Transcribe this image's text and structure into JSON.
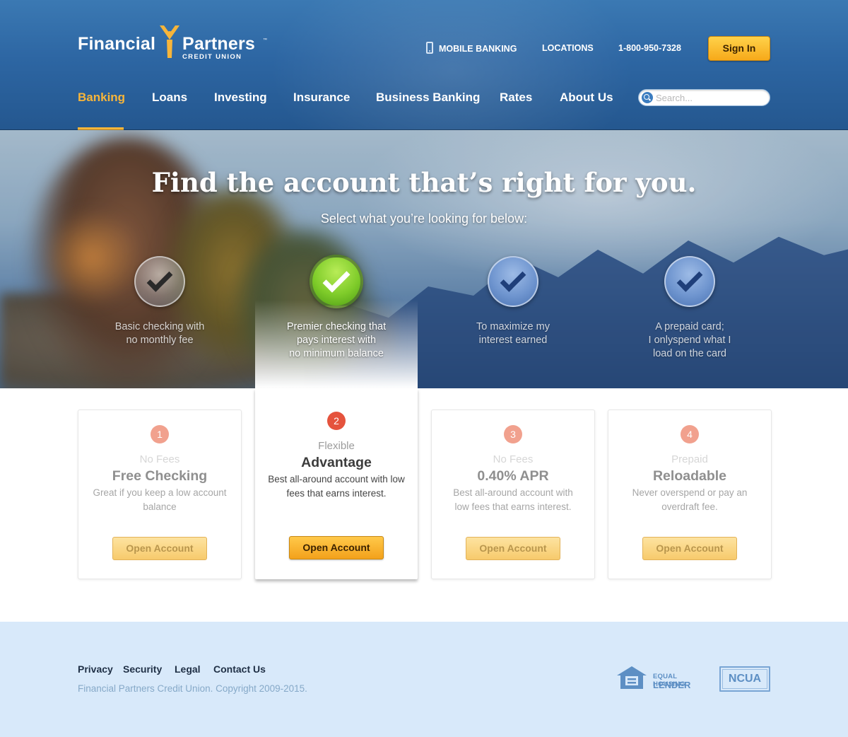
{
  "brand": {
    "name_part1": "Financial",
    "name_part2": "Partners",
    "trademark": "™",
    "subtitle": "CREDIT UNION"
  },
  "utility_nav": {
    "mobile_banking": "MOBILE BANKING",
    "locations": "LOCATIONS",
    "phone": "1-800-950-7328",
    "sign_in": "Sign In"
  },
  "main_nav": {
    "items": [
      {
        "label": "Banking",
        "active": true
      },
      {
        "label": "Loans"
      },
      {
        "label": "Investing"
      },
      {
        "label": "Insurance"
      },
      {
        "label": "Business Banking"
      },
      {
        "label": "Rates"
      },
      {
        "label": "About Us"
      }
    ]
  },
  "search": {
    "placeholder": "Search...",
    "value": ""
  },
  "hero": {
    "title": "Find the account that’s right for you.",
    "subtitle": "Select what you’re looking for below:",
    "options": [
      {
        "text": "Basic checking with\nno monthly fee",
        "selected": false
      },
      {
        "text": "Premier checking that\npays interest with\nno minimum balance",
        "selected": true
      },
      {
        "text": "To maximize my\ninterest earned",
        "selected": false
      },
      {
        "text": "A prepaid card;\nI onlyspend what I\nload on the card",
        "selected": false
      }
    ]
  },
  "cards": [
    {
      "number": "1",
      "kicker": "No Fees",
      "title": "Free Checking",
      "desc": "Great if you keep a low account balance",
      "button": "Open Account"
    },
    {
      "number": "2",
      "kicker": "Flexible",
      "title": "Advantage",
      "desc": "Best all-around account with low fees that earns interest.",
      "button": "Open Account"
    },
    {
      "number": "3",
      "kicker": "No Fees",
      "title": "0.40% APR",
      "desc": "Best all-around account with low fees that earns interest.",
      "button": "Open Account"
    },
    {
      "number": "4",
      "kicker": "Prepaid",
      "title": "Reloadable",
      "desc": "Never overspend or pay an overdraft fee.",
      "button": "Open Account"
    }
  ],
  "footer": {
    "links": [
      "Privacy",
      "Security",
      "Legal",
      "Contact Us"
    ],
    "copyright": "Financial Partners Credit Union. Copyright 2009-2015.",
    "equal_housing_line1": "EQUAL HOUSING",
    "equal_housing_line2": "LENDER",
    "ncua": "NCUA"
  },
  "colors": {
    "header_blue": "#2d66a3",
    "accent_gold": "#f7b53a",
    "button_gold": "#f6a91a",
    "check_green": "#7fcc2a",
    "badge_red": "#e5533d",
    "footer_bg": "#d8e9fa"
  },
  "icons": [
    "phone-icon",
    "search-icon",
    "checkmark-icon",
    "equal-housing-icon",
    "ncua-logo"
  ]
}
